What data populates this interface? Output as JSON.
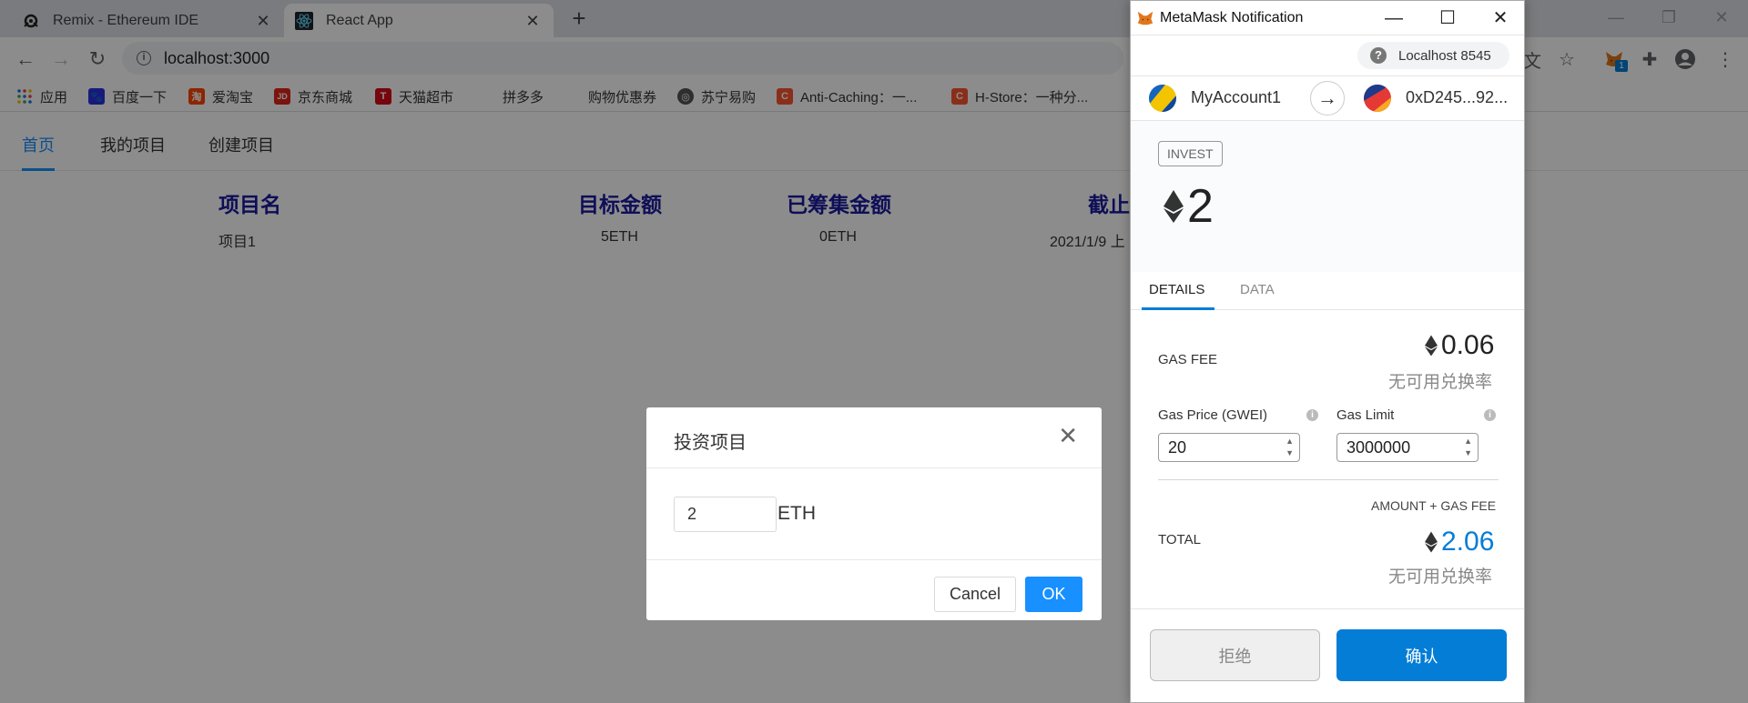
{
  "browser": {
    "tabs": [
      {
        "title": "Remix - Ethereum IDE",
        "icon": "remix-icon"
      },
      {
        "title": "React App",
        "icon": "react-icon"
      }
    ],
    "url": "localhost:3000",
    "bookmarks": [
      {
        "label": "应用",
        "icon": "apps-grid-icon"
      },
      {
        "label": "百度一下",
        "icon": "baidu-icon",
        "color": "#2932e1"
      },
      {
        "label": "爱淘宝",
        "icon": "taobao-icon",
        "color": "#ff4400"
      },
      {
        "label": "京东商城",
        "icon": "jd-icon",
        "color": "#e1251b"
      },
      {
        "label": "天猫超市",
        "icon": "tmall-icon",
        "color": "#d70a18"
      },
      {
        "label": "拼多多",
        "icon": "none"
      },
      {
        "label": "购物优惠券",
        "icon": "none"
      },
      {
        "label": "苏宁易购",
        "icon": "globe-icon"
      },
      {
        "label": "Anti-Caching：一...",
        "icon": "csdn-icon",
        "color": "#fc5531"
      },
      {
        "label": "H-Store：一种分...",
        "icon": "csdn-icon",
        "color": "#fc5531"
      }
    ],
    "extension_badge": "1"
  },
  "page": {
    "menu": [
      "首页",
      "我的项目",
      "创建项目"
    ],
    "table": {
      "headers": [
        "项目名",
        "目标金额",
        "已筹集金额",
        "截止"
      ],
      "row": [
        "项目1",
        "5ETH",
        "0ETH",
        "2021/1/9 上"
      ]
    }
  },
  "modal": {
    "title": "投资项目",
    "amount_value": "2",
    "unit": "ETH",
    "cancel_label": "Cancel",
    "ok_label": "OK"
  },
  "metamask": {
    "window_title": "MetaMask Notification",
    "network": "Localhost 8545",
    "from_account": "MyAccount1",
    "to_address": "0xD245...92...",
    "action": "INVEST",
    "amount": "2",
    "tabs": [
      "DETAILS",
      "DATA"
    ],
    "gas_fee_label": "GAS FEE",
    "gas_fee_value": "0.06",
    "no_rate_text": "无可用兑换率",
    "gas_price_label": "Gas Price (GWEI)",
    "gas_price_value": "20",
    "gas_limit_label": "Gas Limit",
    "gas_limit_value": "3000000",
    "amount_gas_label": "AMOUNT + GAS FEE",
    "total_label": "TOTAL",
    "total_value": "2.06",
    "reject_label": "拒绝",
    "confirm_label": "确认",
    "accent_color": "#037dd6"
  }
}
